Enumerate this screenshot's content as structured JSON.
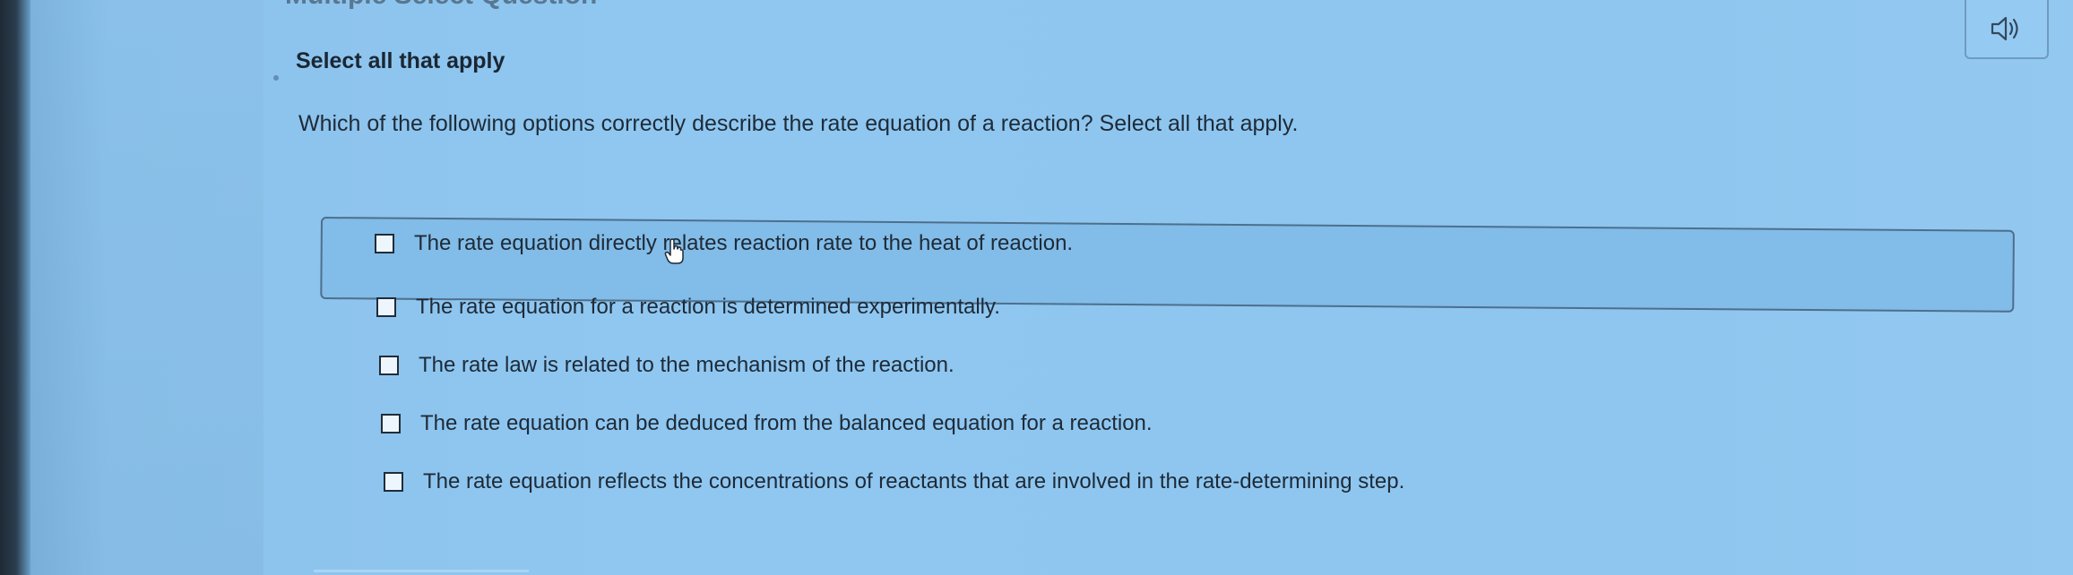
{
  "header": {
    "partial_title": "Multiple Select Question",
    "audio_button_icon": "speaker-icon"
  },
  "prompt": {
    "instruction": "Select all that apply",
    "question": "Which of the following options correctly describe the rate equation of a reaction? Select all that apply."
  },
  "options": [
    {
      "label": "The rate equation directly relates reaction rate to the heat of reaction.",
      "checked": false,
      "hovered": true
    },
    {
      "label": "The rate equation for a reaction is determined experimentally.",
      "checked": false
    },
    {
      "label": "The rate law is related to the mechanism of the reaction.",
      "checked": false
    },
    {
      "label": "The rate equation can be deduced from the balanced equation for a reaction.",
      "checked": false
    },
    {
      "label": "The rate equation reflects the concentrations of reactants that are involved in the rate-determining step.",
      "checked": false
    }
  ],
  "colors": {
    "background": "#8fc7f1",
    "text": "#1e2a36",
    "highlight": "#82bce8"
  }
}
